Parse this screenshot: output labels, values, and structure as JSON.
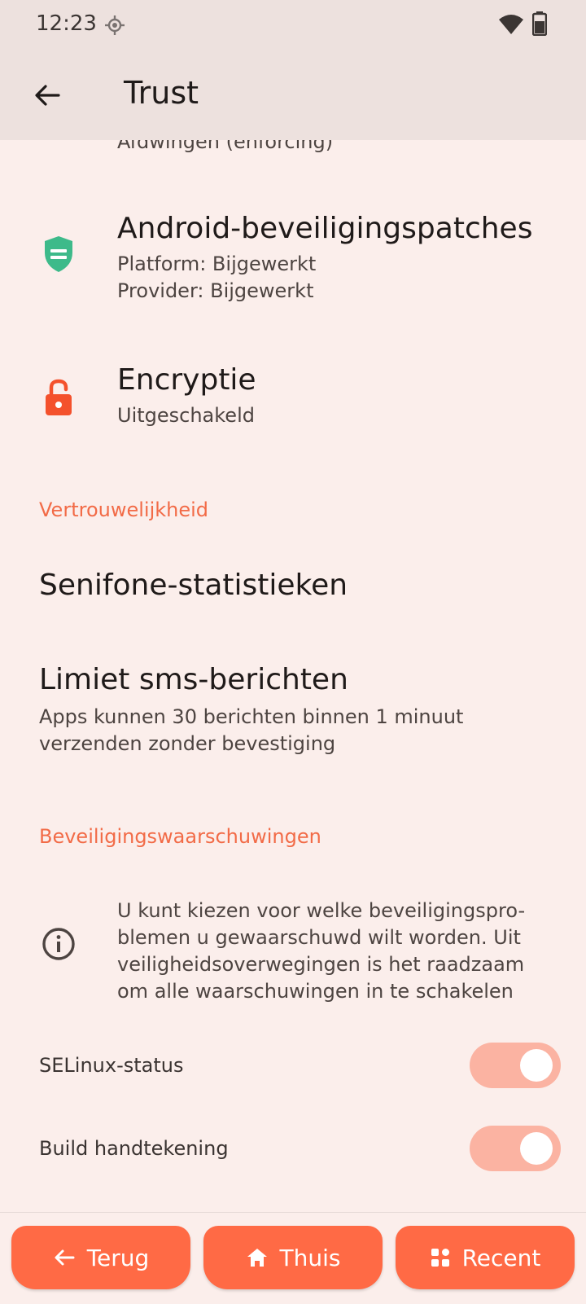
{
  "status": {
    "time": "12:23"
  },
  "appbar": {
    "title": "Trust"
  },
  "items": {
    "selinux_sub": "Afdwingen (enforcing)",
    "patches_title": "Android-beveiligingspatches",
    "patches_platform": "Platform: Bijgewerkt",
    "patches_provider": "Provider: Bijgewerkt",
    "encryption_title": "Encryptie",
    "encryption_sub": "Uitgeschakeld"
  },
  "privacy": {
    "header": "Vertrouwelijkheid",
    "stats_title": "Senifone-statistieken",
    "sms_title": "Limiet sms-berichten",
    "sms_sub_line1": "Apps kunnen 30 berichten binnen 1 minuut",
    "sms_sub_line2": "verzenden zonder bevestiging"
  },
  "warnings": {
    "header": "Beveiligingswaarschuwingen",
    "info_line1": "U kunt kiezen voor welke beveiligingspro-",
    "info_line2": "blemen u gewaarschuwd wilt worden. Uit",
    "info_line3": "veiligheidsoverwegingen is het raadzaam",
    "info_line4": "om alle waarschuwingen in te schakelen",
    "toggles": [
      {
        "label": "SELinux-status",
        "on": true
      },
      {
        "label": "Build handtekening",
        "on": true
      }
    ]
  },
  "nav": {
    "back_label": "Terug",
    "home_label": "Thuis",
    "recent_label": "Recent"
  },
  "colors": {
    "accent": "#ff6a45",
    "section_header": "#f26b47",
    "shield": "#3dba8a",
    "lock": "#f4512c",
    "switch_track": "#fbb3a2",
    "background": "#fbeeeb"
  }
}
